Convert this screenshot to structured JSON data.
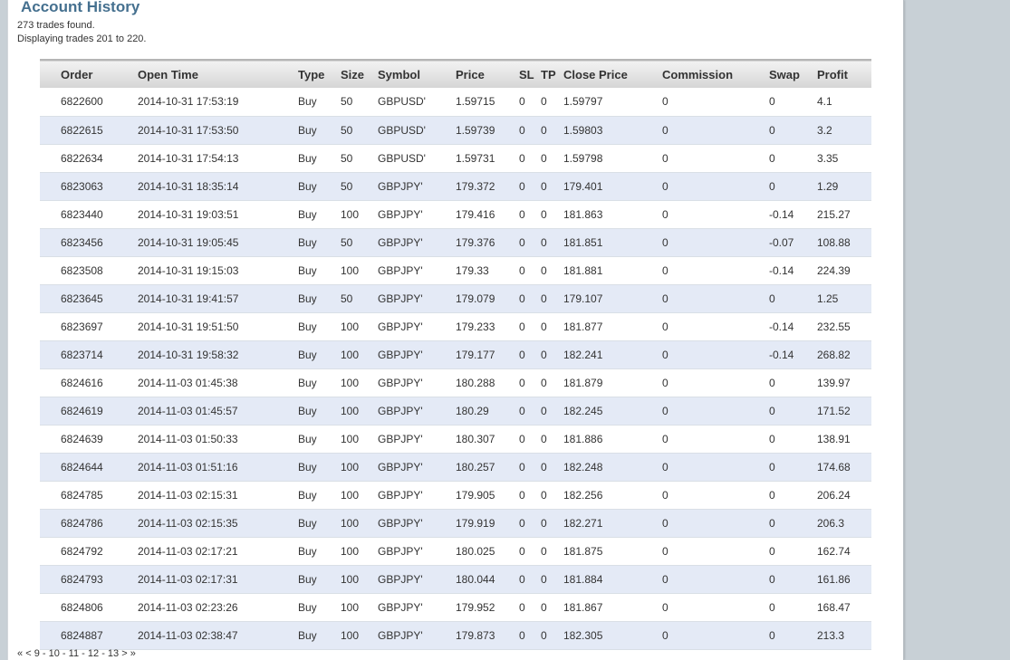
{
  "page": {
    "title": "Account History",
    "summary_count": "273 trades found.",
    "summary_range": "Displaying trades 201 to 220."
  },
  "table": {
    "columns": [
      "Order",
      "Open Time",
      "Type",
      "Size",
      "Symbol",
      "Price",
      "SL",
      "TP",
      "Close Price",
      "Commission",
      "Swap",
      "Profit"
    ],
    "rows": [
      [
        "6822600",
        "2014-10-31 17:53:19",
        "Buy",
        "50",
        "GBPUSD'",
        "1.59715",
        "0",
        "0",
        "1.59797",
        "0",
        "0",
        "4.1"
      ],
      [
        "6822615",
        "2014-10-31 17:53:50",
        "Buy",
        "50",
        "GBPUSD'",
        "1.59739",
        "0",
        "0",
        "1.59803",
        "0",
        "0",
        "3.2"
      ],
      [
        "6822634",
        "2014-10-31 17:54:13",
        "Buy",
        "50",
        "GBPUSD'",
        "1.59731",
        "0",
        "0",
        "1.59798",
        "0",
        "0",
        "3.35"
      ],
      [
        "6823063",
        "2014-10-31 18:35:14",
        "Buy",
        "50",
        "GBPJPY'",
        "179.372",
        "0",
        "0",
        "179.401",
        "0",
        "0",
        "1.29"
      ],
      [
        "6823440",
        "2014-10-31 19:03:51",
        "Buy",
        "100",
        "GBPJPY'",
        "179.416",
        "0",
        "0",
        "181.863",
        "0",
        "-0.14",
        "215.27"
      ],
      [
        "6823456",
        "2014-10-31 19:05:45",
        "Buy",
        "50",
        "GBPJPY'",
        "179.376",
        "0",
        "0",
        "181.851",
        "0",
        "-0.07",
        "108.88"
      ],
      [
        "6823508",
        "2014-10-31 19:15:03",
        "Buy",
        "100",
        "GBPJPY'",
        "179.33",
        "0",
        "0",
        "181.881",
        "0",
        "-0.14",
        "224.39"
      ],
      [
        "6823645",
        "2014-10-31 19:41:57",
        "Buy",
        "50",
        "GBPJPY'",
        "179.079",
        "0",
        "0",
        "179.107",
        "0",
        "0",
        "1.25"
      ],
      [
        "6823697",
        "2014-10-31 19:51:50",
        "Buy",
        "100",
        "GBPJPY'",
        "179.233",
        "0",
        "0",
        "181.877",
        "0",
        "-0.14",
        "232.55"
      ],
      [
        "6823714",
        "2014-10-31 19:58:32",
        "Buy",
        "100",
        "GBPJPY'",
        "179.177",
        "0",
        "0",
        "182.241",
        "0",
        "-0.14",
        "268.82"
      ],
      [
        "6824616",
        "2014-11-03 01:45:38",
        "Buy",
        "100",
        "GBPJPY'",
        "180.288",
        "0",
        "0",
        "181.879",
        "0",
        "0",
        "139.97"
      ],
      [
        "6824619",
        "2014-11-03 01:45:57",
        "Buy",
        "100",
        "GBPJPY'",
        "180.29",
        "0",
        "0",
        "182.245",
        "0",
        "0",
        "171.52"
      ],
      [
        "6824639",
        "2014-11-03 01:50:33",
        "Buy",
        "100",
        "GBPJPY'",
        "180.307",
        "0",
        "0",
        "181.886",
        "0",
        "0",
        "138.91"
      ],
      [
        "6824644",
        "2014-11-03 01:51:16",
        "Buy",
        "100",
        "GBPJPY'",
        "180.257",
        "0",
        "0",
        "182.248",
        "0",
        "0",
        "174.68"
      ],
      [
        "6824785",
        "2014-11-03 02:15:31",
        "Buy",
        "100",
        "GBPJPY'",
        "179.905",
        "0",
        "0",
        "182.256",
        "0",
        "0",
        "206.24"
      ],
      [
        "6824786",
        "2014-11-03 02:15:35",
        "Buy",
        "100",
        "GBPJPY'",
        "179.919",
        "0",
        "0",
        "182.271",
        "0",
        "0",
        "206.3"
      ],
      [
        "6824792",
        "2014-11-03 02:17:21",
        "Buy",
        "100",
        "GBPJPY'",
        "180.025",
        "0",
        "0",
        "181.875",
        "0",
        "0",
        "162.74"
      ],
      [
        "6824793",
        "2014-11-03 02:17:31",
        "Buy",
        "100",
        "GBPJPY'",
        "180.044",
        "0",
        "0",
        "181.884",
        "0",
        "0",
        "161.86"
      ],
      [
        "6824806",
        "2014-11-03 02:23:26",
        "Buy",
        "100",
        "GBPJPY'",
        "179.952",
        "0",
        "0",
        "181.867",
        "0",
        "0",
        "168.47"
      ],
      [
        "6824887",
        "2014-11-03 02:38:47",
        "Buy",
        "100",
        "GBPJPY'",
        "179.873",
        "0",
        "0",
        "182.305",
        "0",
        "0",
        "213.3"
      ]
    ]
  },
  "pagination": {
    "items": [
      "«",
      "<",
      "9",
      "-",
      "10",
      "-",
      "11",
      "-",
      "12",
      "-",
      "13",
      ">",
      "»"
    ]
  },
  "colors": {
    "title": "#45708f",
    "row_alt": "#e4eaf6",
    "background": "#c8d0d6"
  }
}
